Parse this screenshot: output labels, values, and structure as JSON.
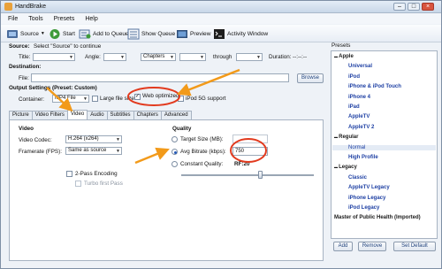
{
  "window": {
    "title": "HandBrake"
  },
  "menu": [
    "File",
    "Tools",
    "Presets",
    "Help"
  ],
  "toolbar": {
    "source": "Source",
    "start": "Start",
    "add_to_queue": "Add to Queue",
    "show_queue": "Show Queue",
    "preview": "Preview",
    "activity_window": "Activity Window"
  },
  "source": {
    "label": "Source:",
    "value": "Select \"Source\" to continue",
    "title_label": "Title:",
    "angle_label": "Angle:",
    "chapters_value": "Chapters",
    "through_label": "through",
    "duration_label": "Duration:",
    "duration_value": "--:--:--"
  },
  "destination": {
    "label": "Destination:",
    "file_label": "File:",
    "browse": "Browse"
  },
  "output": {
    "label": "Output Settings (Preset: Custom)",
    "container_label": "Container:",
    "container_value": "MP4 File",
    "large_file": "Large file size",
    "web_optimized": "Web optimized",
    "ipod": "iPod 5G support"
  },
  "tabs": [
    "Picture",
    "Video Filters",
    "Video",
    "Audio",
    "Subtitles",
    "Chapters",
    "Advanced"
  ],
  "video": {
    "heading": "Video",
    "codec_label": "Video Codec:",
    "codec_value": "H.264 (x264)",
    "framerate_label": "Framerate (FPS):",
    "framerate_value": "Same as source",
    "two_pass": "2-Pass Encoding",
    "turbo": "Turbo first Pass"
  },
  "quality": {
    "heading": "Quality",
    "target_size": "Target Size (MB):",
    "avg_bitrate": "Avg Bitrate (kbps):",
    "avg_bitrate_value": "750",
    "constant_quality": "Constant Quality:",
    "rf": "RF:20"
  },
  "presets": {
    "heading": "Presets",
    "items": [
      {
        "label": "Apple",
        "kind": "group",
        "selected": false
      },
      {
        "label": "Universal",
        "kind": "child",
        "selected": false
      },
      {
        "label": "iPod",
        "kind": "child",
        "selected": false
      },
      {
        "label": "iPhone & iPod Touch",
        "kind": "child",
        "selected": false
      },
      {
        "label": "iPhone 4",
        "kind": "child",
        "selected": false
      },
      {
        "label": "iPad",
        "kind": "child",
        "selected": false
      },
      {
        "label": "AppleTV",
        "kind": "child",
        "selected": false
      },
      {
        "label": "AppleTV 2",
        "kind": "child",
        "selected": false
      },
      {
        "label": "Regular",
        "kind": "group",
        "selected": false
      },
      {
        "label": "Normal",
        "kind": "child",
        "selected": true
      },
      {
        "label": "High Profile",
        "kind": "child",
        "selected": false
      },
      {
        "label": "Legacy",
        "kind": "group",
        "selected": false
      },
      {
        "label": "Classic",
        "kind": "child",
        "selected": false
      },
      {
        "label": "AppleTV Legacy",
        "kind": "child",
        "selected": false
      },
      {
        "label": "iPhone Legacy",
        "kind": "child",
        "selected": false
      },
      {
        "label": "iPod Legacy",
        "kind": "child",
        "selected": false
      },
      {
        "label": "Master of Public Health (Imported)",
        "kind": "group",
        "selected": false
      }
    ],
    "add": "Add",
    "remove": "Remove",
    "set_default": "Set Default"
  },
  "colors": {
    "annotation_orange": "#f29a1a",
    "annotation_red": "#e23a1e",
    "link_blue": "#1d3fa3"
  },
  "icons": {
    "source": "film-icon",
    "start": "play-icon",
    "add_to_queue": "queue-add-icon",
    "show_queue": "queue-icon",
    "preview": "preview-icon",
    "activity_window": "terminal-icon"
  }
}
